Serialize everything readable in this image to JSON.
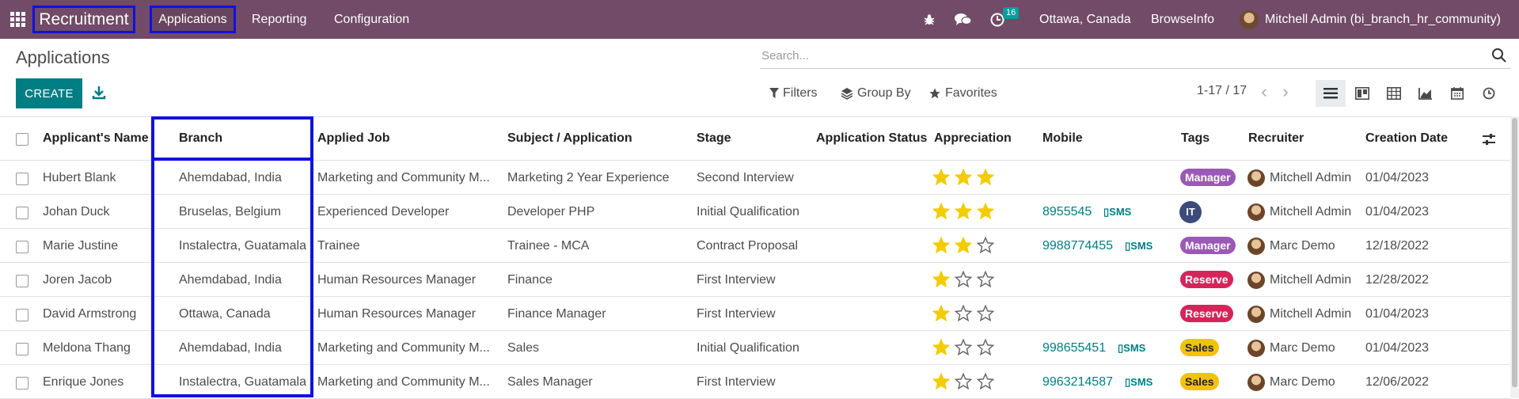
{
  "navbar": {
    "app_name": "Recruitment",
    "menu": [
      "Applications",
      "Reporting",
      "Configuration"
    ],
    "activity_count": "16",
    "location": "Ottawa, Canada",
    "company": "BrowseInfo",
    "user": "Mitchell Admin (bi_branch_hr_community)",
    "color": "#714b67"
  },
  "control": {
    "title": "Applications",
    "search_placeholder": "Search...",
    "create_label": "CREATE",
    "filters_label": "Filters",
    "groupby_label": "Group By",
    "favorites_label": "Favorites",
    "pager": "1-17 / 17",
    "accent": "#017e84"
  },
  "columns": [
    "Applicant's Name",
    "Branch",
    "Applied Job",
    "Subject / Application",
    "Stage",
    "Application Status",
    "Appreciation",
    "Mobile",
    "Tags",
    "Recruiter",
    "Creation Date"
  ],
  "rows": [
    {
      "name": "Hubert Blank",
      "branch": "Ahemdabad, India",
      "job": "Marketing and Community M...",
      "subject": "Marketing 2 Year Experience",
      "stage": "Second Interview",
      "stars": 3,
      "mobile": "",
      "sms": "",
      "tag": "Manager",
      "tag_color": "#9b59b6",
      "recruiter": "Mitchell Admin",
      "date": "01/04/2023"
    },
    {
      "name": "Johan Duck",
      "branch": "Bruselas, Belgium",
      "job": "Experienced Developer",
      "subject": "Developer PHP",
      "stage": "Initial Qualification",
      "stars": 3,
      "mobile": "8955545",
      "sms": "SMS",
      "tag": "IT",
      "tag_color": "#3d4b7a",
      "recruiter": "Mitchell Admin",
      "date": "01/04/2023"
    },
    {
      "name": "Marie Justine",
      "branch": "Instalectra, Guatamala",
      "job": "Trainee",
      "subject": "Trainee - MCA",
      "stage": "Contract Proposal",
      "stars": 2,
      "mobile": "9988774455",
      "sms": "SMS",
      "tag": "Manager",
      "tag_color": "#9b59b6",
      "recruiter": "Marc Demo",
      "date": "12/18/2022"
    },
    {
      "name": "Joren Jacob",
      "branch": "Ahemdabad, India",
      "job": "Human Resources Manager",
      "subject": "Finance",
      "stage": "First Interview",
      "stars": 1,
      "mobile": "",
      "sms": "",
      "tag": "Reserve",
      "tag_color": "#d6245b",
      "recruiter": "Mitchell Admin",
      "date": "12/28/2022"
    },
    {
      "name": "David Armstrong",
      "branch": "Ottawa, Canada",
      "job": "Human Resources Manager",
      "subject": "Finance Manager",
      "stage": "First Interview",
      "stars": 1,
      "mobile": "",
      "sms": "",
      "tag": "Reserve",
      "tag_color": "#d6245b",
      "recruiter": "Mitchell Admin",
      "date": "01/04/2023"
    },
    {
      "name": "Meldona Thang",
      "branch": "Ahemdabad, India",
      "job": "Marketing and Community M...",
      "subject": "Sales",
      "stage": "Initial Qualification",
      "stars": 1,
      "mobile": "998655451",
      "sms": "SMS",
      "tag": "Sales",
      "tag_color": "#f4c20d",
      "recruiter": "Marc Demo",
      "date": "01/04/2023"
    },
    {
      "name": "Enrique Jones",
      "branch": "Instalectra, Guatamala",
      "job": "Marketing and Community M...",
      "subject": "Sales Manager",
      "stage": "First Interview",
      "stars": 1,
      "mobile": "9963214587",
      "sms": "SMS",
      "tag": "Sales",
      "tag_color": "#f4c20d",
      "recruiter": "Marc Demo",
      "date": "12/06/2022"
    }
  ]
}
